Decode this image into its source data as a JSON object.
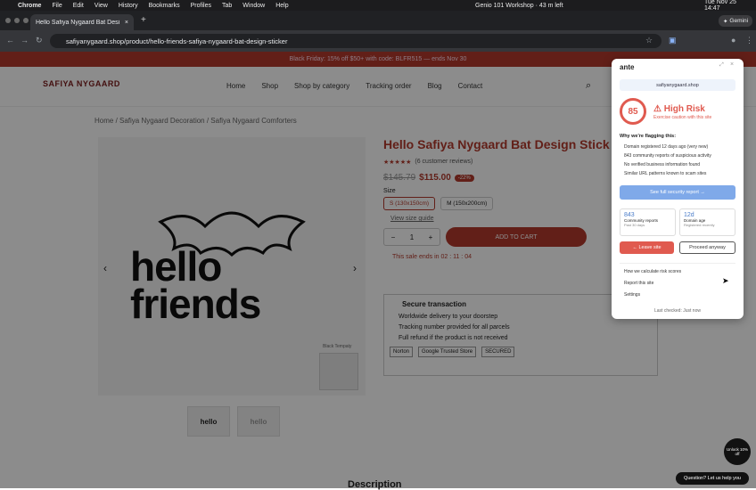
{
  "macbar": {
    "app": "Chrome",
    "menus": [
      "File",
      "Edit",
      "View",
      "History",
      "Bookmarks",
      "Profiles",
      "Tab",
      "Window",
      "Help"
    ],
    "calendar": "Genio 101 Workshop · 43 m left",
    "datetime": "Tue Nov 25  14:47"
  },
  "browser": {
    "tab_title": "Hello Safiya Nygaard Bat Desi",
    "url": "safiyanygaard.shop/product/hello-friends-safiya-nygaard-bat-design-sticker",
    "gemini": "Gemini"
  },
  "site": {
    "promo": "Black Friday: 15% off $50+ with code: BLFR515 — ends Nov 30",
    "logo": "SAFIYA NYGAARD",
    "nav": [
      "Home",
      "Shop",
      "Shop by category",
      "Tracking order",
      "Blog",
      "Contact"
    ],
    "breadcrumb": "Home / Safiya Nygaard Decoration / Safiya Nygaard Comforters",
    "product": {
      "title": "Hello Safiya Nygaard Bat Design Stick",
      "reviews": "(6 customer reviews)",
      "old_price": "$145.79",
      "price": "$115.00",
      "discount": "-22%",
      "size_label": "Size",
      "sizes": [
        "S (130x150cm)",
        "M (150x200cm)"
      ],
      "size_guide": "View size guide",
      "qty": "1",
      "add_to_cart": "ADD TO CART",
      "sale_timer": "This sale ends in 02 : 11 : 04",
      "image_text_1": "hello",
      "image_text_2": "friends",
      "bundle_label": "Black Tempaty",
      "secure_title": "Secure transaction",
      "secure_items": [
        "Worldwide delivery to your doorstep",
        "Tracking number provided for all parcels",
        "Full refund if the product is not received"
      ],
      "badges": [
        "Norton",
        "Google Trusted Store",
        "SECURED"
      ]
    },
    "description_heading": "Description",
    "unlock": "Unlock 10% off",
    "chat": "Question? Let us help you"
  },
  "popup": {
    "brand": "ante",
    "domain": "safiyanygaard.shop",
    "score": "85",
    "risk_title": "High Risk",
    "risk_sub": "Exercise caution with this site",
    "flag_heading": "Why we're flagging this:",
    "flags": [
      "Domain registered 12 days ago (very new)",
      "843 community reports of suspicious activity",
      "No verified business information found",
      "Similar URL patterns known to scam sites"
    ],
    "report_button": "See full security report →",
    "stats": [
      {
        "value": "843",
        "label": "Community reports",
        "sub": "Past 30 days"
      },
      {
        "value": "12d",
        "label": "Domain age",
        "sub": "Registered recently"
      }
    ],
    "leave_button": "← Leave site",
    "proceed_button": "Proceed anyway",
    "links": [
      "How we calculate risk scores",
      "Report this site",
      "Settings"
    ],
    "footer": "Last checked: Just now",
    "accent": "#e05a4f"
  }
}
